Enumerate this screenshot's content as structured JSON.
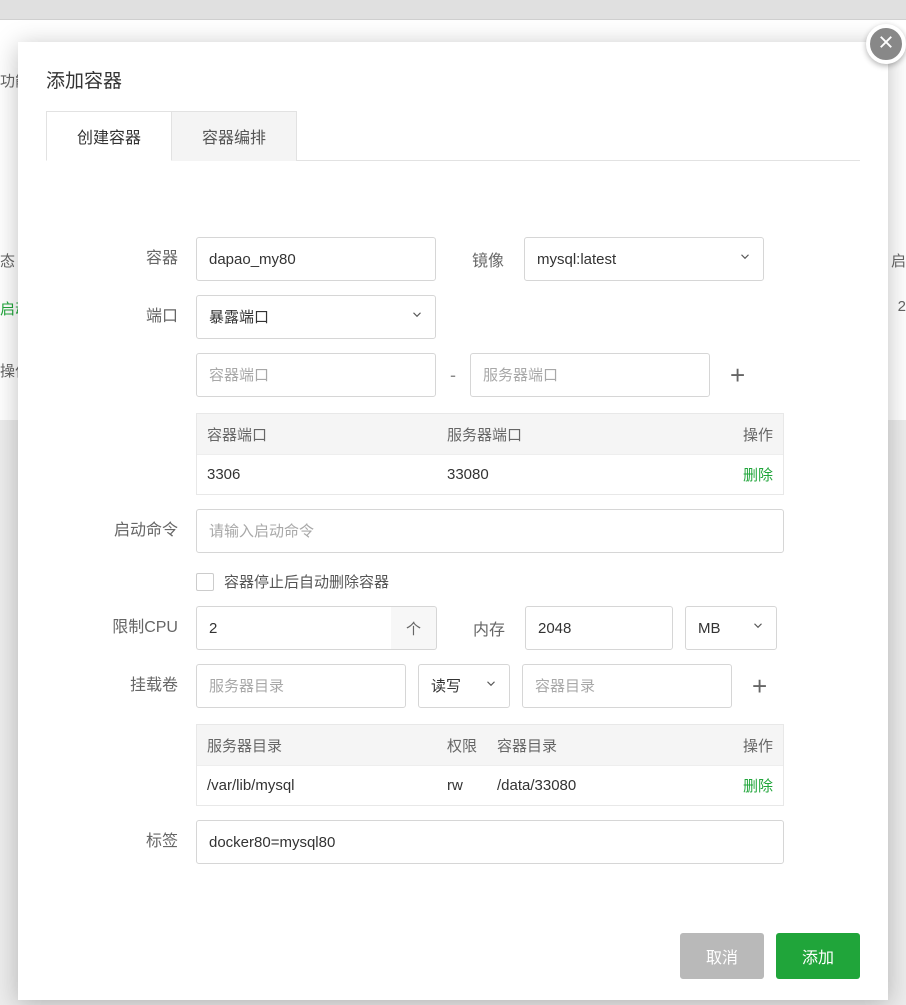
{
  "background": {
    "frag_fn": "功能",
    "frag_tai": "态",
    "frag_qi": "启动",
    "frag_cao": "操作",
    "frag_qir": "启",
    "frag_two": "2"
  },
  "modal": {
    "title": "添加容器",
    "tabs": {
      "create": "创建容器",
      "compose": "容器编排"
    },
    "labels": {
      "container": "容器",
      "image": "镜像",
      "port": "端口",
      "start_cmd": "启动命令",
      "cpu": "限制CPU",
      "memory": "内存",
      "volume": "挂载卷",
      "tag": "标签"
    },
    "fields": {
      "container_name": "dapao_my80",
      "image_value": "mysql:latest",
      "port_mode": "暴露端口",
      "container_port_ph": "容器端口",
      "server_port_ph": "服务器端口",
      "start_cmd_ph": "请输入启动命令",
      "auto_remove_label": "容器停止后自动删除容器",
      "cpu_value": "2",
      "cpu_unit": "个",
      "mem_value": "2048",
      "mem_unit": "MB",
      "server_dir_ph": "服务器目录",
      "vol_mode": "读写",
      "container_dir_ph": "容器目录",
      "tag_value": "docker80=mysql80"
    },
    "port_table": {
      "headers": {
        "c1": "容器端口",
        "c2": "服务器端口",
        "c3": "操作"
      },
      "row": {
        "c1": "3306",
        "c2": "33080",
        "del": "删除"
      }
    },
    "vol_table": {
      "headers": {
        "c1": "服务器目录",
        "c1b": "权限",
        "c2": "容器目录",
        "c3": "操作"
      },
      "row": {
        "c1": "/var/lib/mysql",
        "c1b": "rw",
        "c2": "/data/33080",
        "del": "删除"
      }
    },
    "buttons": {
      "cancel": "取消",
      "add": "添加"
    }
  }
}
